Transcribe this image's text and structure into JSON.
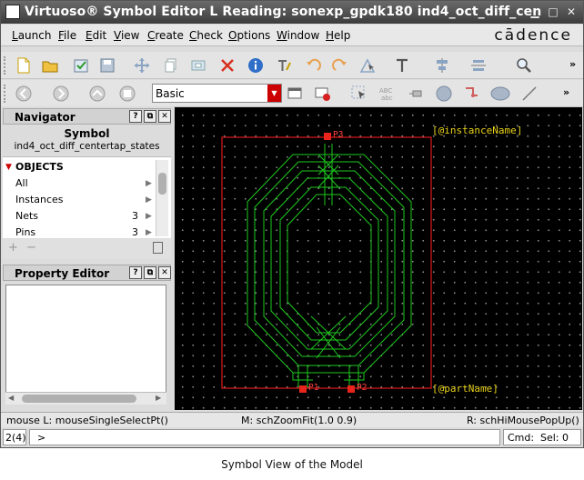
{
  "window": {
    "title": "Virtuoso® Symbol Editor L Reading: sonexp_gpdk180 ind4_oct_diff_cen"
  },
  "menus": [
    "Launch",
    "File",
    "Edit",
    "View",
    "Create",
    "Check",
    "Options",
    "Window",
    "Help"
  ],
  "menu_mnemonics": [
    "L",
    "F",
    "E",
    "V",
    "C",
    "C",
    "O",
    "W",
    "H"
  ],
  "brand": "cādence",
  "toolbar": {
    "filter_value": "Basic",
    "overflow": "»"
  },
  "navigator": {
    "title": "Navigator",
    "view_label": "Symbol",
    "cell_name": "ind4_oct_diff_centertap_states",
    "objects_header": "OBJECTS",
    "items": [
      {
        "label": "All",
        "count": ""
      },
      {
        "label": "Instances",
        "count": ""
      },
      {
        "label": "Nets",
        "count": "3"
      },
      {
        "label": "Pins",
        "count": "3"
      }
    ]
  },
  "property_editor": {
    "title": "Property Editor"
  },
  "canvas": {
    "instance_label": "[@instanceName]",
    "part_label": "[@partName]",
    "pins": [
      "P3",
      "P1",
      "P2"
    ]
  },
  "status": {
    "left": "mouse L: mouseSingleSelectPt()",
    "middle": "M: schZoomFit(1.0 0.9)",
    "right": "R: schHiMousePopUp()"
  },
  "cmdline": {
    "counter": "2(4)",
    "prompt": ">",
    "cmd_label": "Cmd:",
    "sel_label": "Sel: 0"
  },
  "caption": "Symbol View of the Model",
  "colors": {
    "wire": "#1ec81e",
    "box": "#e01818",
    "pin": "#e8241c",
    "label": "#e8d21a",
    "pin_text": "#ff4040"
  }
}
